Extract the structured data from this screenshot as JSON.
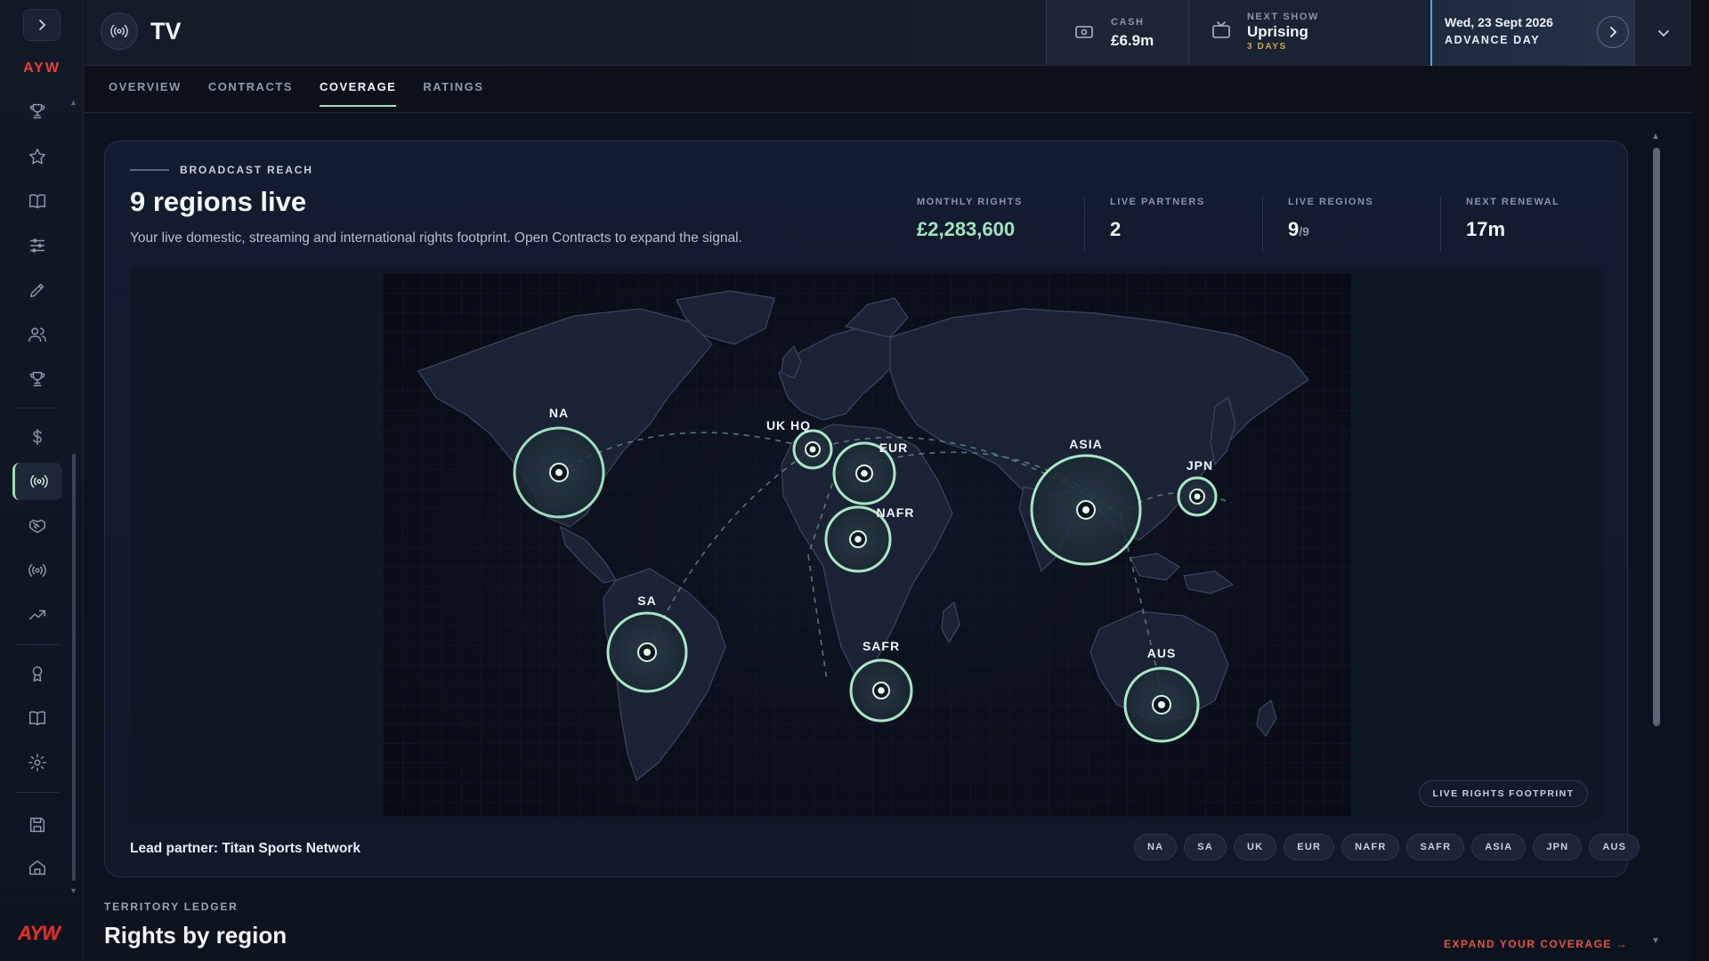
{
  "sidebar": {
    "brand": "AYW",
    "logo": "AYW",
    "items": [
      {
        "icon": "trophy-icon"
      },
      {
        "icon": "star-icon"
      },
      {
        "icon": "book-icon"
      },
      {
        "icon": "sliders-icon"
      },
      {
        "icon": "pencil-icon"
      },
      {
        "icon": "users-icon"
      },
      {
        "icon": "trophy-icon"
      },
      {
        "icon": "dollar-icon"
      },
      {
        "icon": "broadcast-icon",
        "active": true
      },
      {
        "icon": "handshake-icon"
      },
      {
        "icon": "broadcast-icon"
      },
      {
        "icon": "trend-icon"
      },
      {
        "icon": "award-icon"
      },
      {
        "icon": "book-icon"
      },
      {
        "icon": "gear-icon"
      },
      {
        "icon": "save-icon"
      },
      {
        "icon": "home-icon"
      }
    ]
  },
  "header": {
    "title": "TV",
    "cash_label": "CASH",
    "cash_value": "£6.9m",
    "next_show_label": "NEXT SHOW",
    "next_show_name": "Uprising",
    "next_show_days": "3 DAYS",
    "date": "Wed, 23 Sept 2026",
    "advance_label": "ADVANCE DAY"
  },
  "tabs": [
    {
      "label": "OVERVIEW"
    },
    {
      "label": "CONTRACTS"
    },
    {
      "label": "COVERAGE",
      "active": true
    },
    {
      "label": "RATINGS"
    }
  ],
  "card": {
    "eyebrow": "BROADCAST REACH",
    "title": "9 regions live",
    "description": "Your live domestic, streaming and international rights footprint. Open Contracts to expand the signal.",
    "stats": {
      "monthly_rights_label": "MONTHLY RIGHTS",
      "monthly_rights_value": "£2,283,600",
      "live_partners_label": "LIVE PARTNERS",
      "live_partners_value": "2",
      "live_regions_label": "LIVE REGIONS",
      "live_regions_value": "9",
      "live_regions_total": "/9",
      "next_renewal_label": "NEXT RENEWAL",
      "next_renewal_value": "17m"
    },
    "map_regions": [
      {
        "code": "NA",
        "label": "NA"
      },
      {
        "code": "UKHQ",
        "label": "UK HQ"
      },
      {
        "code": "EUR",
        "label": "EUR"
      },
      {
        "code": "NAFR",
        "label": "NAFR"
      },
      {
        "code": "ASIA",
        "label": "ASIA"
      },
      {
        "code": "JPN",
        "label": "JPN"
      },
      {
        "code": "SA",
        "label": "SA"
      },
      {
        "code": "SAFR",
        "label": "SAFR"
      },
      {
        "code": "AUS",
        "label": "AUS"
      }
    ],
    "footprint_button": "LIVE RIGHTS FOOTPRINT",
    "lead_partner": "Lead partner: Titan Sports Network",
    "region_chips": [
      "NA",
      "SA",
      "UK",
      "EUR",
      "NAFR",
      "SAFR",
      "ASIA",
      "JPN",
      "AUS"
    ]
  },
  "ledger": {
    "eyebrow": "TERRITORY LEDGER",
    "title": "Rights by region",
    "expand_link": "EXPAND YOUR COVERAGE →"
  },
  "colors": {
    "accent_green": "#9fe3bf",
    "accent_red": "#e2563d",
    "accent_gold": "#c8a455",
    "accent_blue": "#5aa3d8"
  }
}
